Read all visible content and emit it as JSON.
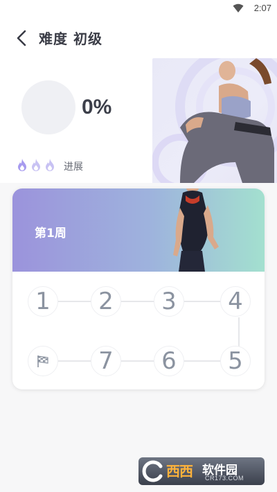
{
  "status_bar": {
    "time": "2:07",
    "wifi_icon": "wifi-icon"
  },
  "header": {
    "title": "难度 初级",
    "back_icon": "chevron-left-icon"
  },
  "summary": {
    "percent": "0%",
    "progress_label": "进展",
    "flame_count": 3,
    "flame_color": "#a79bef"
  },
  "week": {
    "label": "第1周",
    "banner_colors": [
      "#9b93dc",
      "#a3e0cf"
    ],
    "days": [
      "1",
      "2",
      "3",
      "4",
      "5",
      "6",
      "7"
    ],
    "finish_icon": "checkered-flag-icon"
  },
  "watermark": {
    "big": "西西",
    "small": "软件园",
    "url": "CR173.COM"
  }
}
